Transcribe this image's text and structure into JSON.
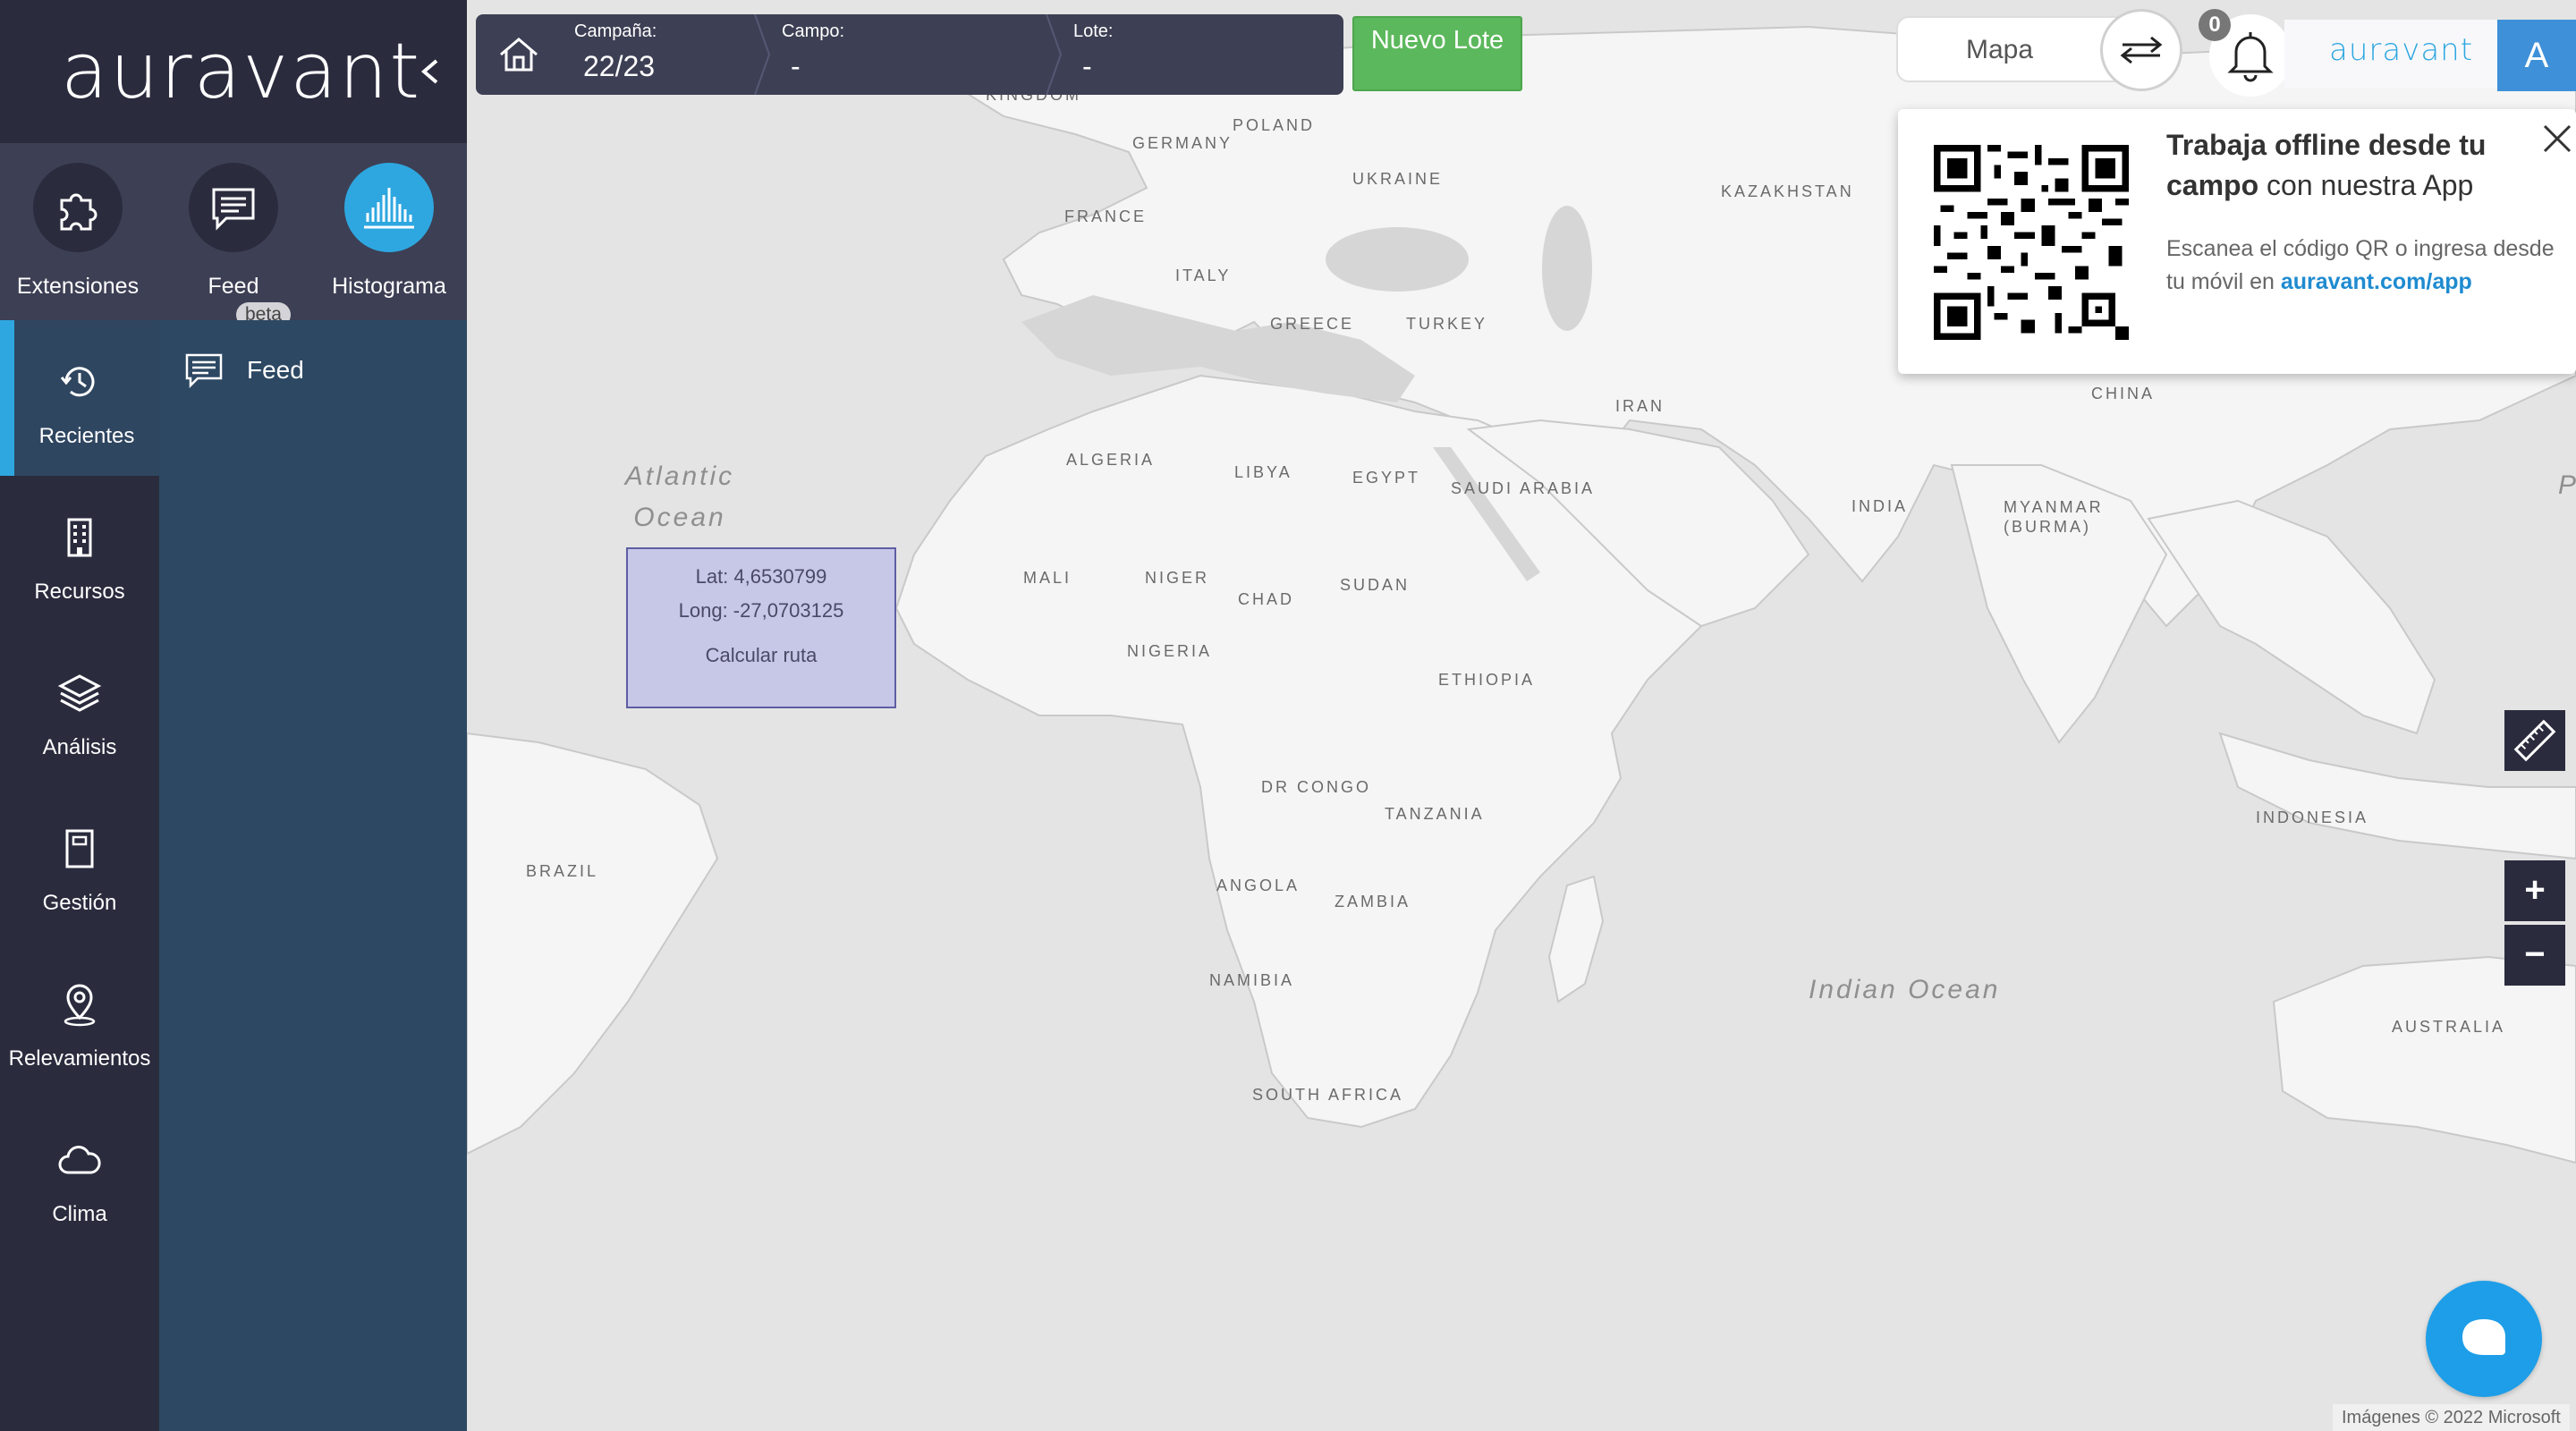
{
  "brand": {
    "logo_text": "auravant",
    "small_logo": "auravant",
    "accent": "#2ea7e0"
  },
  "extensions": [
    {
      "label": "Extensiones",
      "icon": "puzzle-icon"
    },
    {
      "label": "Feed",
      "icon": "chat-icon",
      "badge": "beta"
    },
    {
      "label": "Histograma",
      "icon": "histogram-icon",
      "active": true
    }
  ],
  "nav": [
    {
      "label": "Recientes",
      "icon": "history-icon",
      "active": true
    },
    {
      "label": "Recursos",
      "icon": "building-icon"
    },
    {
      "label": "Análisis",
      "icon": "layers-icon"
    },
    {
      "label": "Gestión",
      "icon": "notebook-icon"
    },
    {
      "label": "Relevamientos",
      "icon": "map-pin-icon"
    },
    {
      "label": "Clima",
      "icon": "cloud-icon"
    }
  ],
  "subpanel": {
    "feed_label": "Feed"
  },
  "topbar": {
    "campaign_caption": "Campaña:",
    "campaign_value": "22/23",
    "field_caption": "Campo:",
    "field_value": "-",
    "lot_caption": "Lote:",
    "lot_value": "-",
    "new_lot_label": "Nuevo Lote"
  },
  "header_right": {
    "map_button": "Mapa",
    "notifications_count": "0",
    "avatar_letter": "A"
  },
  "promo": {
    "title_bold": "Trabaja offline desde tu campo",
    "title_rest": " con nuestra App",
    "desc": "Escanea el código QR o ingresa desde tu móvil en ",
    "link": "auravant.com/app"
  },
  "popup": {
    "lat": "Lat: 4,6530799",
    "lng": "Long: -27,0703125",
    "action": "Calcular ruta"
  },
  "map_labels": {
    "kingdom": "KINGDOM",
    "germany": "GERMANY",
    "poland": "POLAND",
    "ukraine": "UKRAINE",
    "kazakhstan": "KAZAKHSTAN",
    "france": "FRANCE",
    "italy": "ITALY",
    "greece": "GREECE",
    "turkey": "TURKEY",
    "iran": "IRAN",
    "china": "CHINA",
    "algeria": "ALGERIA",
    "libya": "LIBYA",
    "egypt": "EGYPT",
    "saudi": "SAUDI ARABIA",
    "india": "INDIA",
    "myanmar": "MYANMAR (BURMA)",
    "mali": "MALI",
    "niger": "NIGER",
    "chad": "CHAD",
    "sudan": "SUDAN",
    "nigeria": "NIGERIA",
    "ethiopia": "ETHIOPIA",
    "drcongo": "DR CONGO",
    "tanzania": "TANZANIA",
    "angola": "ANGOLA",
    "zambia": "ZAMBIA",
    "namibia": "NAMIBIA",
    "southafrica": "SOUTH AFRICA",
    "brazil": "BRAZIL",
    "indonesia": "INDONESIA",
    "australia": "AUSTRALIA",
    "atlantic": "Atlantic Ocean",
    "indian": "Indian Ocean",
    "edge_p": "P"
  },
  "attribution": "Imágenes © 2022 Microsoft"
}
